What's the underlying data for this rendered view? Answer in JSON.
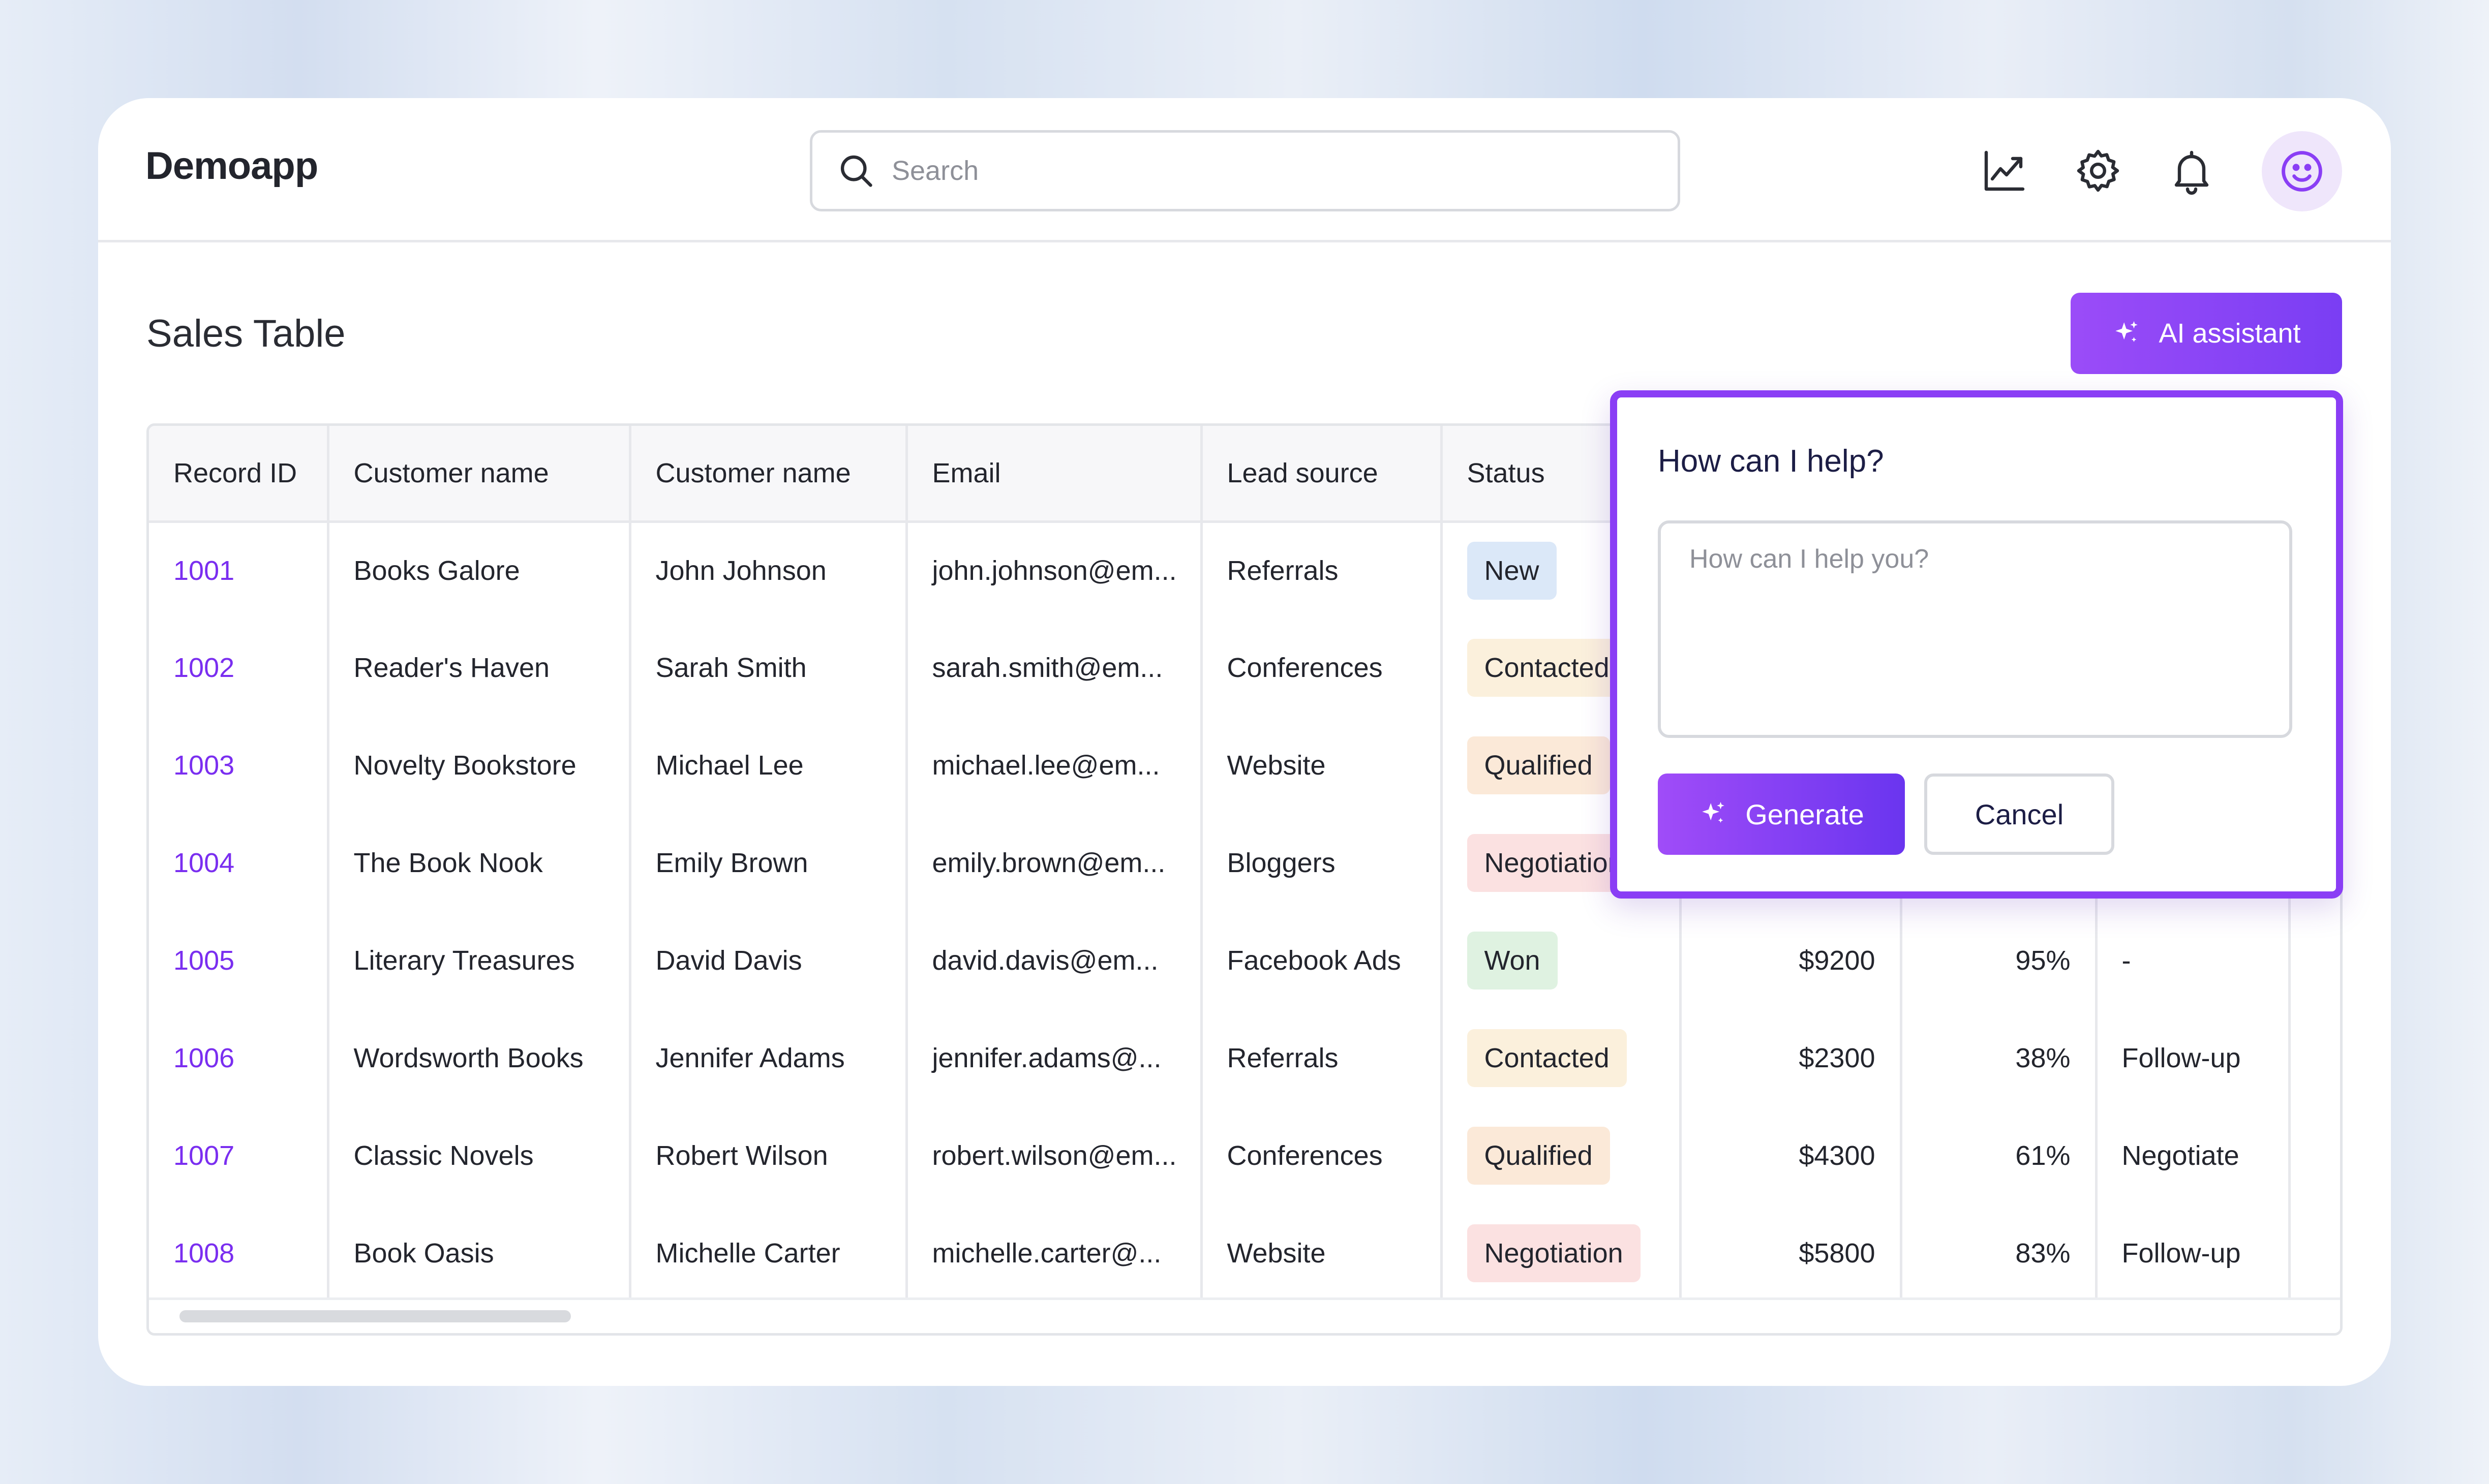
{
  "app": {
    "name": "Demoapp"
  },
  "search": {
    "placeholder": "Search"
  },
  "page": {
    "title": "Sales Table"
  },
  "toolbar": {
    "ai_assistant_label": "AI assistant"
  },
  "table": {
    "columns": [
      "Record ID",
      "Customer name",
      "Customer name",
      "Email",
      "Lead source",
      "Status",
      "",
      "",
      "",
      ""
    ],
    "rows": [
      {
        "id": "1001",
        "company": "Books Galore",
        "contact": "John Johnson",
        "email": "john.johnson@em...",
        "source": "Referrals",
        "status": "New",
        "amount": "",
        "probability": "",
        "next": ""
      },
      {
        "id": "1002",
        "company": "Reader's Haven",
        "contact": "Sarah Smith",
        "email": "sarah.smith@em...",
        "source": "Conferences",
        "status": "Contacted",
        "amount": "",
        "probability": "",
        "next": ""
      },
      {
        "id": "1003",
        "company": "Novelty Bookstore",
        "contact": "Michael Lee",
        "email": "michael.lee@em...",
        "source": "Website",
        "status": "Qualified",
        "amount": "",
        "probability": "",
        "next": ""
      },
      {
        "id": "1004",
        "company": "The Book Nook",
        "contact": "Emily Brown",
        "email": "emily.brown@em...",
        "source": "Bloggers",
        "status": "Negotiation",
        "amount": "",
        "probability": "",
        "next": ""
      },
      {
        "id": "1005",
        "company": "Literary Treasures",
        "contact": "David Davis",
        "email": "david.davis@em...",
        "source": "Facebook Ads",
        "status": "Won",
        "amount": "$9200",
        "probability": "95%",
        "next": "-"
      },
      {
        "id": "1006",
        "company": "Wordsworth Books",
        "contact": "Jennifer Adams",
        "email": "jennifer.adams@...",
        "source": "Referrals",
        "status": "Contacted",
        "amount": "$2300",
        "probability": "38%",
        "next": "Follow-up"
      },
      {
        "id": "1007",
        "company": "Classic Novels",
        "contact": "Robert Wilson",
        "email": "robert.wilson@em...",
        "source": "Conferences",
        "status": "Qualified",
        "amount": "$4300",
        "probability": "61%",
        "next": "Negotiate"
      },
      {
        "id": "1008",
        "company": "Book Oasis",
        "contact": "Michelle Carter",
        "email": "michelle.carter@...",
        "source": "Website",
        "status": "Negotiation",
        "amount": "$5800",
        "probability": "83%",
        "next": "Follow-up"
      }
    ]
  },
  "status_colors": {
    "New": "#dbe8f8",
    "Contacted": "#fbf0dc",
    "Qualified": "#fbe9d8",
    "Negotiation": "#fbe1e1",
    "Won": "#dff2e1"
  },
  "assistant": {
    "title": "How can I help?",
    "placeholder": "How can I help you?",
    "generate_label": "Generate",
    "cancel_label": "Cancel"
  },
  "icons": {
    "search": "search-icon",
    "analytics": "chart-line-icon",
    "settings": "gear-icon",
    "notifications": "bell-icon",
    "avatar": "smiley-icon",
    "sparkle": "sparkle-icon"
  },
  "colors": {
    "accent": "#8a3ef5",
    "link": "#7a2ef0"
  }
}
